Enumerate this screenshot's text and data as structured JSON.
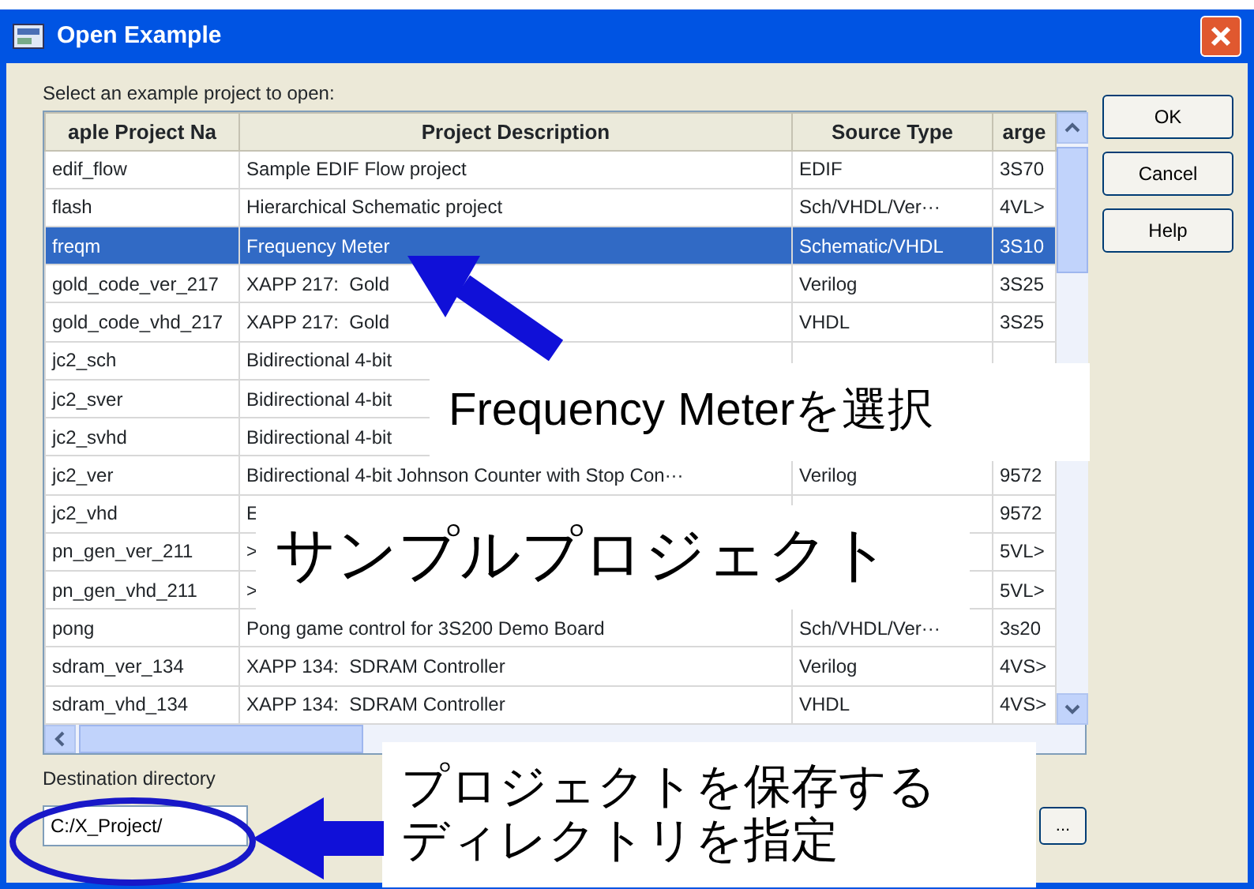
{
  "window": {
    "title": "Open Example"
  },
  "prompt": "Select an example project to open:",
  "table": {
    "columns": [
      "aple Project Na",
      "Project Description",
      "Source Type",
      "arge"
    ],
    "rows": [
      {
        "name": "edif_flow",
        "description": "Sample EDIF Flow project",
        "source": "EDIF",
        "target": "3S70",
        "selected": false
      },
      {
        "name": "flash",
        "description": "Hierarchical Schematic project",
        "source": "Sch/VHDL/Ver···",
        "target": "4VL>",
        "selected": false
      },
      {
        "name": "freqm",
        "description": "Frequency Meter",
        "source": "Schematic/VHDL",
        "target": "3S10",
        "selected": true
      },
      {
        "name": "gold_code_ver_217",
        "description": "XAPP 217:  Gold",
        "source": "Verilog",
        "target": "3S25",
        "selected": false
      },
      {
        "name": "gold_code_vhd_217",
        "description": "XAPP 217:  Gold",
        "source": "VHDL",
        "target": "3S25",
        "selected": false
      },
      {
        "name": "jc2_sch",
        "description": "Bidirectional 4-bit",
        "selected": false
      },
      {
        "name": "jc2_sver",
        "description": "Bidirectional 4-bit",
        "selected": false
      },
      {
        "name": "jc2_svhd",
        "description": "Bidirectional 4-bit",
        "selected": false
      },
      {
        "name": "jc2_ver",
        "description": "Bidirectional 4-bit Johnson Counter with Stop Con···",
        "source": "Verilog",
        "target": "9572",
        "selected": false
      },
      {
        "name": "jc2_vhd",
        "description": "E",
        "target": "9572",
        "selected": false
      },
      {
        "name": "pn_gen_ver_211",
        "description": ">",
        "target": "5VL>",
        "selected": false
      },
      {
        "name": "pn_gen_vhd_211",
        "description": ">",
        "target": "5VL>",
        "selected": false
      },
      {
        "name": "pong",
        "description": "Pong game control for 3S200 Demo Board",
        "source": "Sch/VHDL/Ver···",
        "target": "3s20",
        "selected": false
      },
      {
        "name": "sdram_ver_134",
        "description": "XAPP 134:  SDRAM Controller",
        "source": "Verilog",
        "target": "4VS>",
        "selected": false
      },
      {
        "name": "sdram_vhd_134",
        "description": "XAPP 134:  SDRAM Controller",
        "source": "VHDL",
        "target": "4VS>",
        "selected": false
      }
    ]
  },
  "destination": {
    "label": "Destination directory",
    "value": "C:/X_Project/",
    "browse": "..."
  },
  "buttons": [
    "OK",
    "Cancel",
    "Help"
  ],
  "annotations": [
    {
      "kind": "callout",
      "lines": [
        "Frequency Meterを選択"
      ]
    },
    {
      "kind": "banner",
      "lines": [
        "サンプルプロジェクト"
      ]
    },
    {
      "kind": "footer",
      "lines": [
        "プロジェクトを保存する",
        "ディレクトリを指定"
      ]
    }
  ]
}
